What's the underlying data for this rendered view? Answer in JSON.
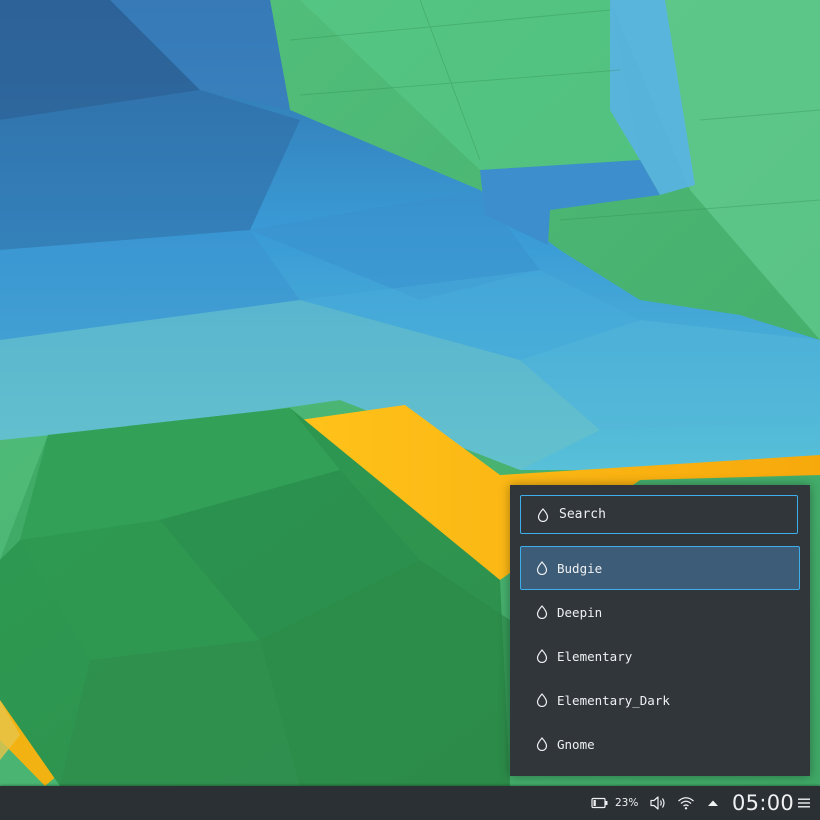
{
  "launcher_popup": {
    "search_placeholder": "Search",
    "items": [
      {
        "label": "Budgie",
        "selected": true
      },
      {
        "label": "Deepin",
        "selected": false
      },
      {
        "label": "Elementary",
        "selected": false
      },
      {
        "label": "Elementary_Dark",
        "selected": false
      },
      {
        "label": "Gnome",
        "selected": false
      }
    ],
    "item_icon": "drop-icon"
  },
  "taskbar": {
    "battery_percent": "23%",
    "battery_level": 0.23,
    "clock": "05:00",
    "icons": [
      "battery-icon",
      "volume-icon",
      "wifi-icon",
      "expand-arrow-icon",
      "hamburger-menu-icon"
    ]
  },
  "colors": {
    "panel_bg": "#31363b",
    "taskbar_bg": "#2b3034",
    "accent": "#3daee9",
    "selection_bg": "#3c5c78",
    "text": "#eff0f1"
  }
}
